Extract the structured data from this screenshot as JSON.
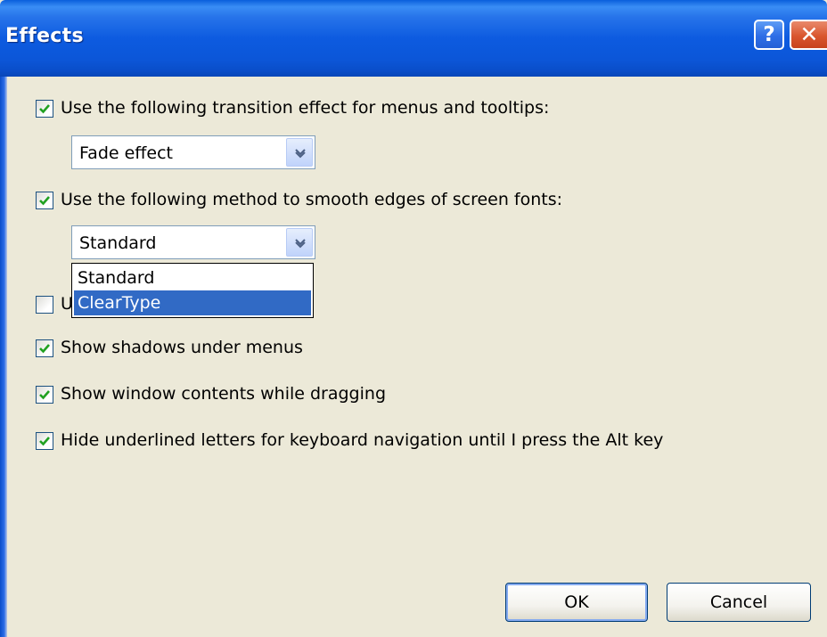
{
  "window": {
    "title": "Effects",
    "help_label": "?",
    "close_label": "✕"
  },
  "options": [
    {
      "id": "transition",
      "label": "Use the following transition effect for menus and tooltips:",
      "checked": true
    },
    {
      "id": "smooth_edges",
      "label": "Use the following method to smooth edges of screen fonts:",
      "checked": true
    },
    {
      "id": "large_icons",
      "label": "U",
      "checked": false
    },
    {
      "id": "shadows",
      "label": "Show shadows under menus",
      "checked": true
    },
    {
      "id": "drag_contents",
      "label": "Show window contents while dragging",
      "checked": true
    },
    {
      "id": "hide_underlines",
      "label": "Hide underlined letters for keyboard navigation until I press the Alt key",
      "checked": true
    }
  ],
  "transition_combo": {
    "value": "Fade effect"
  },
  "smoothing_combo": {
    "value": "Standard",
    "options": [
      "Standard",
      "ClearType"
    ],
    "highlighted": "ClearType"
  },
  "buttons": {
    "ok": "OK",
    "cancel": "Cancel"
  },
  "colors": {
    "title_bar": "#0c56d8",
    "face": "#ece9d8",
    "selection": "#316ac5",
    "checkmark": "#21a121"
  },
  "icons": {
    "help": "question-mark-icon",
    "close": "close-x-icon",
    "checkmark": "checkmark-icon",
    "dropdown": "chevron-down-icon"
  }
}
